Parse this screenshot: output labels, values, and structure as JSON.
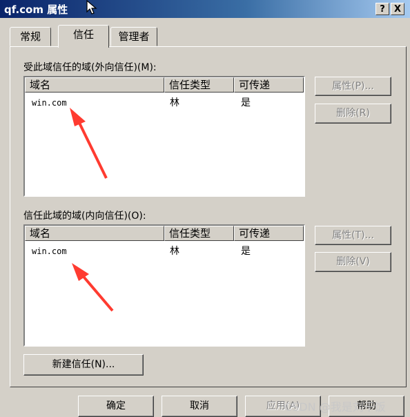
{
  "window": {
    "title": "qf.com 属性",
    "help_button": "?",
    "close_button": "X"
  },
  "tabs": [
    {
      "label": "常规"
    },
    {
      "label": "信任"
    },
    {
      "label": "管理者"
    }
  ],
  "outgoing": {
    "label": "受此域信任的域(外向信任)(M):",
    "columns": [
      "域名",
      "信任类型",
      "可传递"
    ],
    "rows": [
      [
        "win.com",
        "林",
        "是"
      ]
    ],
    "properties_button": "属性(P)...",
    "remove_button": "删除(R)"
  },
  "incoming": {
    "label": "信任此域的域(内向信任)(O):",
    "columns": [
      "域名",
      "信任类型",
      "可传递"
    ],
    "rows": [
      [
        "win.com",
        "林",
        "是"
      ]
    ],
    "properties_button": "属性(T)...",
    "remove_button": "删除(V)"
  },
  "new_trust_button": "新建信任(N)...",
  "footer": {
    "ok": "确定",
    "cancel": "取消",
    "apply": "应用(A)",
    "help": "帮助"
  },
  "watermark": "CSDN @我是刘干饭",
  "colors": {
    "title_gradient_start": "#0a246a",
    "face": "#d4d0c8",
    "annotation_arrow": "#ff3b30"
  }
}
